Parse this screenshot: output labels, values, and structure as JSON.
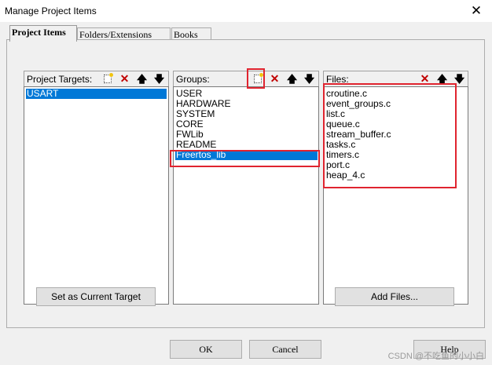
{
  "window": {
    "title": "Manage Project Items",
    "close_glyph": "✕"
  },
  "tabs": [
    "Project Items",
    "Folders/Extensions",
    "Books"
  ],
  "targets": {
    "header": "Project Targets:",
    "items": [
      "USART"
    ],
    "selected": 0,
    "button": "Set as Current Target"
  },
  "groups": {
    "header": "Groups:",
    "items": [
      "USER",
      "HARDWARE",
      "SYSTEM",
      "CORE",
      "FWLib",
      "README",
      "Freertos_lib"
    ],
    "selected": 6
  },
  "files": {
    "header": "Files:",
    "items": [
      "croutine.c",
      "event_groups.c",
      "list.c",
      "queue.c",
      "stream_buffer.c",
      "tasks.c",
      "timers.c",
      "port.c",
      "heap_4.c"
    ],
    "button": "Add Files..."
  },
  "footer": {
    "ok": "OK",
    "cancel": "Cancel",
    "help": "Help"
  },
  "icons": {
    "new": "new-item-icon",
    "delete": "delete-icon",
    "up": "move-up-icon",
    "down": "move-down-icon"
  },
  "watermark": "CSDN @不吃鱼的小小白",
  "colors": {
    "selection": "#0078d7",
    "highlight": "#e0242f",
    "delete_icon": "#c00000"
  }
}
